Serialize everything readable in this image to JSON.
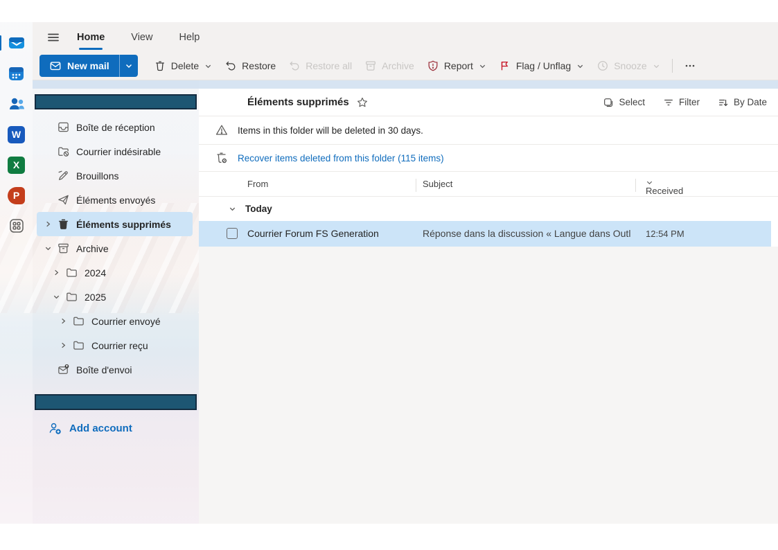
{
  "colors": {
    "accent": "#0f6cbd",
    "selection": "#cde4f7",
    "redaction": "#1d5673",
    "flag": "#c50f1f",
    "report": "#9d323d"
  },
  "rail": {
    "items": [
      "outlook-mail",
      "calendar",
      "people",
      "word",
      "excel",
      "powerpoint",
      "app-launcher"
    ],
    "word_letter": "W",
    "excel_letter": "X",
    "powerpoint_letter": "P"
  },
  "tabs": {
    "items": [
      {
        "label": "Home",
        "active": true
      },
      {
        "label": "View",
        "active": false
      },
      {
        "label": "Help",
        "active": false
      }
    ]
  },
  "toolbar": {
    "new_mail": "New mail",
    "buttons": [
      {
        "label": "Delete",
        "icon": "trash",
        "chevron": true,
        "disabled": false
      },
      {
        "label": "Restore",
        "icon": "undo",
        "chevron": false,
        "disabled": false
      },
      {
        "label": "Restore all",
        "icon": "undo",
        "chevron": false,
        "disabled": true
      },
      {
        "label": "Archive",
        "icon": "archive",
        "chevron": false,
        "disabled": true
      },
      {
        "label": "Report",
        "icon": "shield",
        "chevron": true,
        "disabled": false
      },
      {
        "label": "Flag / Unflag",
        "icon": "flag",
        "chevron": true,
        "disabled": false
      },
      {
        "label": "Snooze",
        "icon": "clock",
        "chevron": true,
        "disabled": true
      }
    ]
  },
  "sidebar": {
    "folders": [
      {
        "label": "Boîte de réception",
        "icon": "inbox",
        "indent": 1
      },
      {
        "label": "Courrier indésirable",
        "icon": "junk",
        "indent": 1
      },
      {
        "label": "Brouillons",
        "icon": "draft",
        "indent": 1
      },
      {
        "label": "Éléments envoyés",
        "icon": "send",
        "indent": 1
      },
      {
        "label": "Éléments supprimés",
        "icon": "trash",
        "indent": 1,
        "chevron": "right",
        "selected": true
      },
      {
        "label": "Archive",
        "icon": "archive",
        "indent": 1,
        "chevron": "down"
      },
      {
        "label": "2024",
        "icon": "folder",
        "indent": 2,
        "chevron": "right"
      },
      {
        "label": "2025",
        "icon": "folder",
        "indent": 2,
        "chevron": "down"
      },
      {
        "label": "Courrier envoyé",
        "icon": "folder",
        "indent": 3,
        "chevron": "right"
      },
      {
        "label": "Courrier reçu",
        "icon": "folder",
        "indent": 3,
        "chevron": "right"
      },
      {
        "label": "Boîte d'envoi",
        "icon": "outbox",
        "indent": 1
      }
    ],
    "add_account": "Add account"
  },
  "list": {
    "title": "Éléments supprimés",
    "actions": [
      {
        "label": "Select",
        "icon": "select"
      },
      {
        "label": "Filter",
        "icon": "filter"
      },
      {
        "label": "By Date",
        "icon": "sort"
      }
    ],
    "banners": [
      {
        "text": "Items in this folder will be deleted in 30 days."
      },
      {
        "text": "Recover items deleted from this folder (115 items)"
      }
    ],
    "columns": {
      "from": "From",
      "subject": "Subject",
      "received": "Received"
    },
    "group": "Today",
    "messages": [
      {
        "from": "Courrier Forum FS Generation",
        "subject": "Réponse dans la discussion « Langue dans Outl...",
        "received": "12:54 PM",
        "selected": true
      }
    ]
  }
}
